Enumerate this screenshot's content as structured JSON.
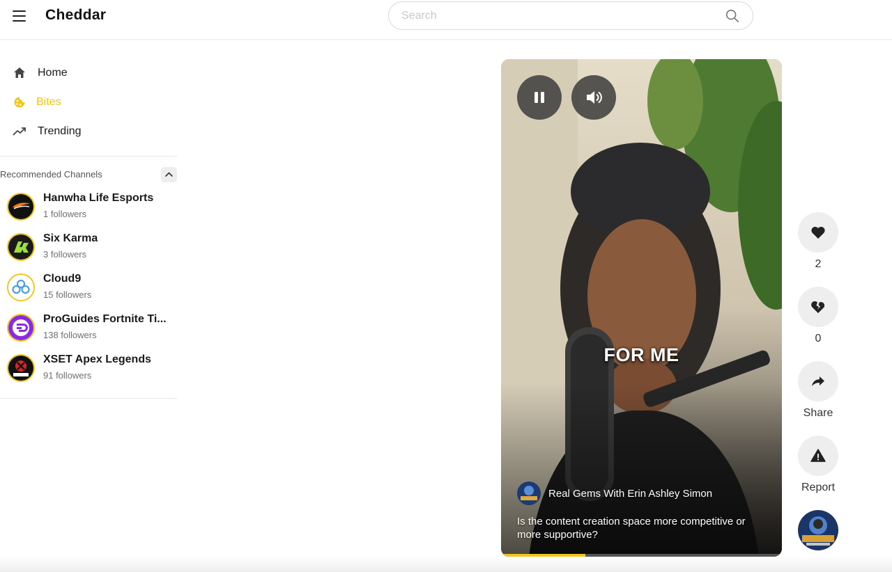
{
  "app": {
    "name": "Cheddar"
  },
  "search": {
    "placeholder": "Search"
  },
  "nav": {
    "items": [
      {
        "label": "Home",
        "icon": "home-icon",
        "active": false
      },
      {
        "label": "Bites",
        "icon": "bites-icon",
        "active": true
      },
      {
        "label": "Trending",
        "icon": "trending-icon",
        "active": false
      }
    ]
  },
  "recommended": {
    "title": "Recommended Channels",
    "channels": [
      {
        "name": "Hanwha Life Esports",
        "followers": "1 followers"
      },
      {
        "name": "Six Karma",
        "followers": "3 followers"
      },
      {
        "name": "Cloud9",
        "followers": "15 followers"
      },
      {
        "name": "ProGuides Fortnite Ti...",
        "followers": "138 followers"
      },
      {
        "name": "XSET Apex Legends",
        "followers": "91 followers"
      }
    ]
  },
  "video": {
    "caption_overlay": "FOR ME",
    "channel_name": "Real Gems With Erin Ashley Simon",
    "description": "Is the content creation space more competitive or more supportive?",
    "progress": 0.3
  },
  "actions": {
    "like_count": "2",
    "dislike_count": "0",
    "share_label": "Share",
    "report_label": "Report"
  },
  "colors": {
    "accent": "#f2c61c",
    "rail_bg": "#eeeeee"
  }
}
